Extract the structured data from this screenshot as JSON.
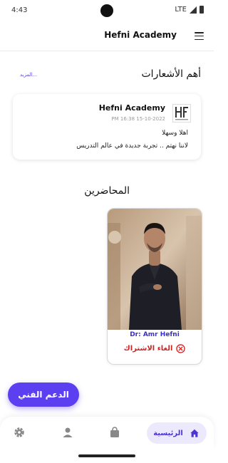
{
  "status_bar": {
    "time": "4:43",
    "network": "LTE"
  },
  "header": {
    "title": "Hefni Academy"
  },
  "notifications": {
    "heading": "أهم الأشعارات",
    "more_link": "المزيد...",
    "card": {
      "title": "Hefni Academy",
      "date": "PM 16:38 15-10-2022",
      "line1": "اهلا وسهلا",
      "line2": "لاننا نهتم .. تجربة جديدة في عالم التدريس"
    }
  },
  "lecturers": {
    "heading": "المحاضرين",
    "items": [
      {
        "name": "Dr: Amr Hefni",
        "unsubscribe_label": "الغاء الاشتراك"
      }
    ]
  },
  "support_button": {
    "label": "الدعم الفني"
  },
  "bottom_nav": {
    "home_label": "الرئيسية",
    "icons": [
      "settings-icon",
      "user-icon",
      "bag-icon",
      "home-icon"
    ]
  },
  "colors": {
    "accent": "#5b3ff0",
    "danger": "#d21f1f",
    "nav_active_bg": "#ece9fd"
  }
}
